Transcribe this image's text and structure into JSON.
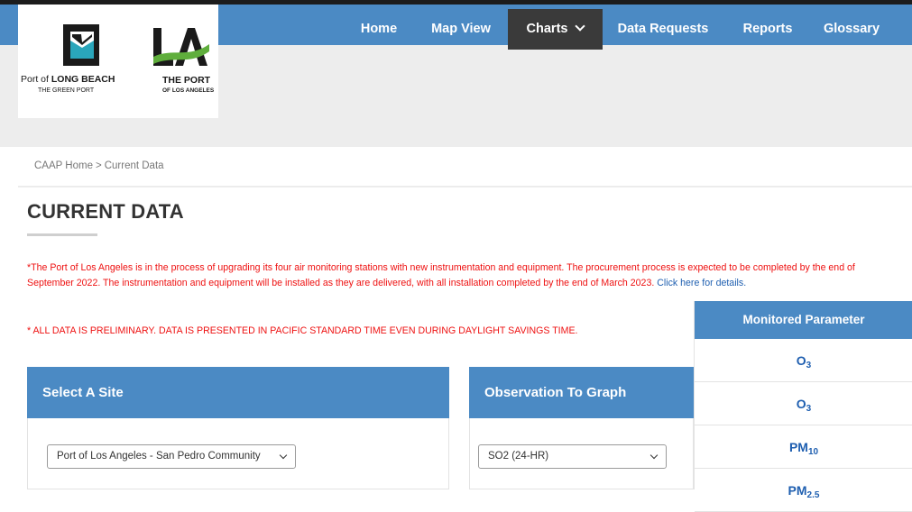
{
  "nav": {
    "items": [
      {
        "label": "Home"
      },
      {
        "label": "Map View"
      },
      {
        "label": "Charts"
      },
      {
        "label": "Data Requests"
      },
      {
        "label": "Reports"
      },
      {
        "label": "Glossary"
      }
    ]
  },
  "logos": {
    "long_beach": {
      "line1_prefix": "Port of",
      "line1_name": "LONG BEACH",
      "line2": "THE GREEN PORT"
    },
    "los_angeles": {
      "mark": "LA",
      "line1": "THE PORT",
      "line2": "OF LOS ANGELES"
    }
  },
  "breadcrumb": {
    "home": "CAAP Home",
    "separator": ">",
    "current": "Current Data"
  },
  "page": {
    "title": "CURRENT DATA",
    "notice_text": "*The Port of Los Angeles is in the process of upgrading its four air monitoring stations with new instrumentation and equipment. The procurement process is expected to be completed by the end of September 2022. The instrumentation and equipment will be installed as they are delivered, with all installation completed by the end of March 2023. ",
    "notice_link": "Click here for details.",
    "preliminary": "* ALL DATA IS PRELIMINARY. DATA IS PRESENTED IN PACIFIC STANDARD TIME EVEN DURING DAYLIGHT SAVINGS TIME."
  },
  "site_panel": {
    "title": "Select A Site",
    "selected": "Port of Los Angeles - San Pedro Community"
  },
  "observation_panel": {
    "title": "Observation To Graph",
    "selected": "SO2 (24-HR)"
  },
  "parameters": {
    "header": "Monitored Parameter",
    "rows": [
      {
        "base": "O",
        "sub": "3"
      },
      {
        "base": "O",
        "sub": "3"
      },
      {
        "base": "PM",
        "sub": "10"
      },
      {
        "base": "PM",
        "sub": "2.5"
      }
    ]
  },
  "colors": {
    "accent": "#4b8ac4",
    "alert": "#ee1111",
    "link": "#1f5fb0",
    "nav_active": "#3a3a3a"
  }
}
